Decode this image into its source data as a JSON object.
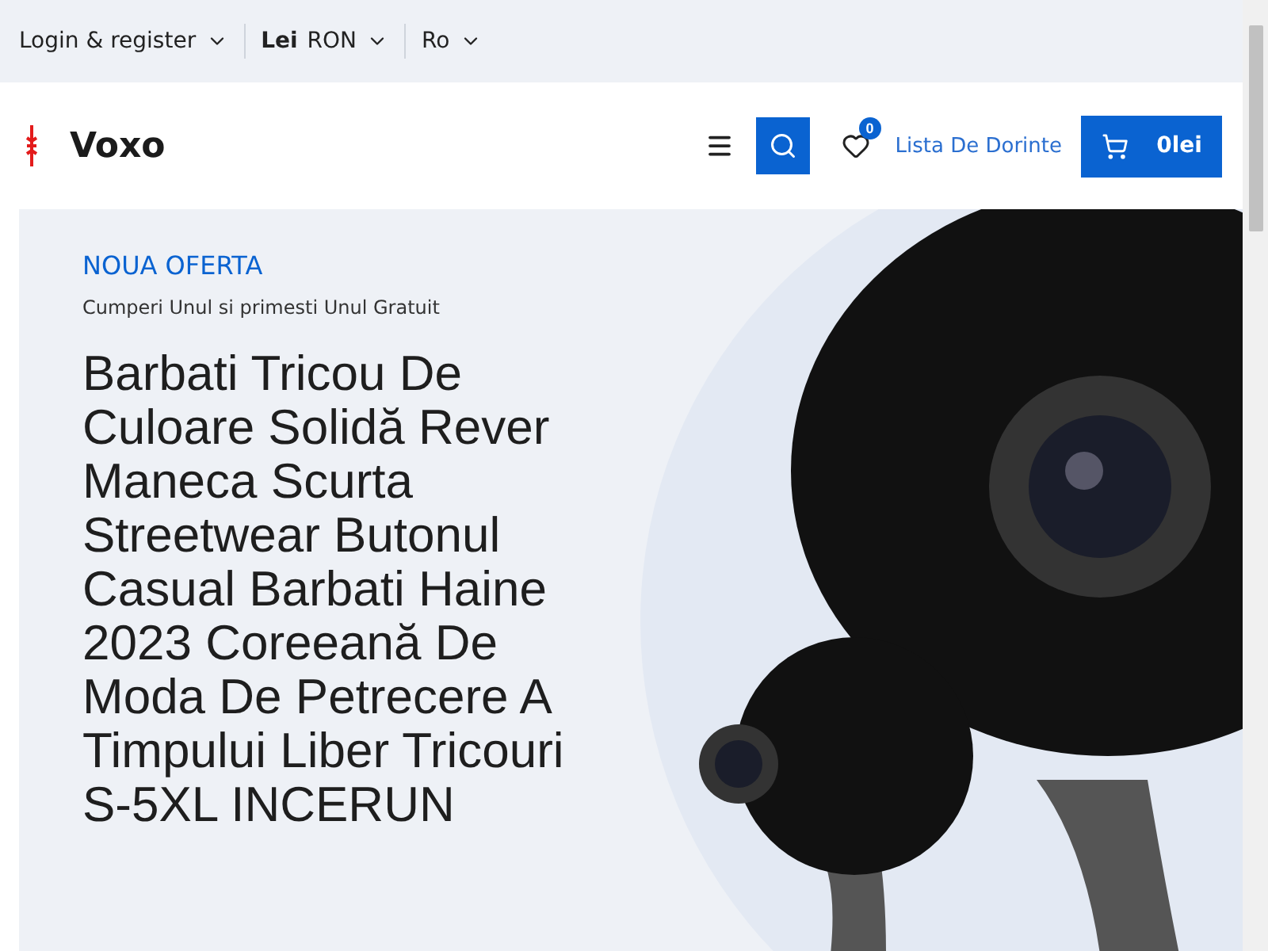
{
  "topbar": {
    "account": {
      "label": "Login & register"
    },
    "currency": {
      "bold": "Lei",
      "label": "RON"
    },
    "language": {
      "label": "Ro"
    }
  },
  "header": {
    "logo": "Voxo",
    "wishlist": {
      "count": "0",
      "label": "Lista De Dorinte"
    },
    "cart": {
      "total": "0lei"
    }
  },
  "hero": {
    "eyebrow": "NOUA OFERTA",
    "subtitle": "Cumperi Unul si primesti Unul Gratuit",
    "title": "Barbati Tricou De Culoare Solidă Rever Maneca Scurta Streetwear Butonul Casual Barbati Haine 2023 Coreeană De Moda De Petrecere A Timpului Liber Tricouri S-5XL INCERUN"
  }
}
